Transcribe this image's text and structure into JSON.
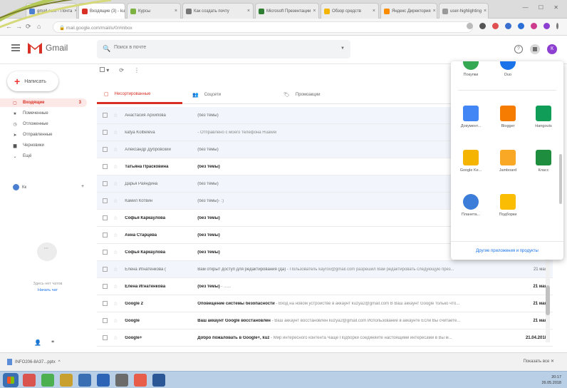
{
  "browser": {
    "tabs": [
      {
        "title": "gmail.com - Почта",
        "color": "#4a7fd1",
        "active": false
      },
      {
        "title": "Входящие (3) - kuz",
        "color": "#d93025",
        "active": true
      },
      {
        "title": "Курсы",
        "color": "#7cb342",
        "active": false
      },
      {
        "title": "Как создать почту",
        "color": "#777777",
        "active": false
      },
      {
        "title": "Microsoft Презентации",
        "color": "#2e7d32",
        "active": false
      },
      {
        "title": "Обзор средств",
        "color": "#f4b400",
        "active": false
      },
      {
        "title": "Яндекс Директория",
        "color": "#fb8c00",
        "active": false
      },
      {
        "title": "user-highlighting",
        "color": "#999999",
        "active": false
      }
    ],
    "url": "mail.google.com/mail/u/0/#inbox",
    "window_controls": "— ☐ ✕"
  },
  "gmail": {
    "logo_word": "Gmail",
    "search_placeholder": "Поиск в почте",
    "help_glyph": "?",
    "avatar_letter": "К",
    "compose_label": "Написать",
    "sidebar": [
      {
        "label": "Входящие",
        "icon": "inbox-icon",
        "glyph": "▢",
        "count": "3",
        "active": true
      },
      {
        "label": "Помеченные",
        "icon": "star-icon",
        "glyph": "★",
        "count": "",
        "active": false
      },
      {
        "label": "Отложенные",
        "icon": "clock-icon",
        "glyph": "◷",
        "count": "",
        "active": false
      },
      {
        "label": "Отправленные",
        "icon": "send-icon",
        "glyph": "➤",
        "count": "",
        "active": false
      },
      {
        "label": "Черновики",
        "icon": "draft-icon",
        "glyph": "▆",
        "count": "",
        "active": false
      },
      {
        "label": "Ещё",
        "icon": "chevron-down-icon",
        "glyph": "⌄",
        "count": "",
        "active": false
      }
    ],
    "hangouts_user": "Кк",
    "no_chats_text": "Здесь нет чатов",
    "start_chat_link": "Начать чат",
    "categories": [
      {
        "label": "Несортированные",
        "icon": "inbox-icon",
        "glyph": "▢",
        "active": true
      },
      {
        "label": "Соцсети",
        "icon": "people-icon",
        "glyph": "👥",
        "active": false
      },
      {
        "label": "Промоакции",
        "icon": "tag-icon",
        "glyph": "🏷",
        "active": false
      }
    ],
    "mails": [
      {
        "sender": "Анастасия Архипова",
        "subject": "(без темы)",
        "snippet": "",
        "date": "",
        "unread": false
      },
      {
        "sender": "katya Kolbeleva",
        "subject": "",
        "snippet": "- Отправлено с моего телефона Huawei",
        "date": "",
        "unread": false
      },
      {
        "sender": "Александр Дубровский",
        "subject": "(без темы)",
        "snippet": "",
        "date": "",
        "unread": false
      },
      {
        "sender": "Татьяна Прасковина",
        "subject": "(без темы)",
        "snippet": "",
        "date": "",
        "unread": true
      },
      {
        "sender": "Дарья Раяндина",
        "subject": "(без темы)",
        "snippet": "",
        "date": "",
        "unread": false
      },
      {
        "sender": "Камил Котвин",
        "subject": "(без темы)",
        "snippet": "- :)",
        "date": "",
        "unread": false
      },
      {
        "sender": "Софья Каркаулова",
        "subject": "(без темы)",
        "snippet": "",
        "date": "",
        "unread": true
      },
      {
        "sender": "Анна Старцева",
        "subject": "(без темы)",
        "snippet": "",
        "date": "",
        "unread": true
      },
      {
        "sender": "Софья Каркаулова",
        "subject": "(без темы)",
        "snippet": "",
        "date": "",
        "unread": true
      },
      {
        "sender": "Елена Игнатенкова (",
        "subject": "Вам открыт доступ для редактирования (да)",
        "snippet": " - Пользователь kayrov@gmail.com разрешил Вам редактировать следующую през...",
        "date": "21 мая",
        "unread": false
      },
      {
        "sender": "Елена Игнатенкова",
        "subject": "(без темы)",
        "snippet": " - ......",
        "date": "21 мая",
        "unread": true
      },
      {
        "sender": "Google 2",
        "subject": "Оповещение системы безопасности",
        "snippet": " - Вход на новом устройстве в аккаунт kuzya2@gmail.com В Ваш аккаунт Google только что...",
        "date": "21 мая",
        "unread": true
      },
      {
        "sender": "Google",
        "subject": "Ваш аккаунт Google восстановлен",
        "snippet": " - Ваш аккаунт восстановлен kuzya2@gmail.com Использование в аккаунте Если Вы считаете...",
        "date": "21 мая",
        "unread": true
      },
      {
        "sender": "Google+",
        "subject": "Добро пожаловать в Google+, kuz",
        "snippet": " - Мир интересного контента Чаще Подборки соединяйте настоящими интересами в Вы м...",
        "date": "21.04.2018",
        "unread": true
      }
    ],
    "apps": {
      "top": [
        {
          "label": "Покупки",
          "color": "#34a853"
        },
        {
          "label": "Duo",
          "color": "#1a73e8"
        }
      ],
      "grid": [
        {
          "label": "Документ...",
          "icon": "docs-icon",
          "color": "#4285f4"
        },
        {
          "label": "Blogger",
          "icon": "blogger-icon",
          "color": "#f57c00"
        },
        {
          "label": "Hangouts",
          "icon": "hangouts-icon",
          "color": "#0f9d58"
        },
        {
          "label": "Google Ke...",
          "icon": "keep-icon",
          "color": "#f4b400"
        },
        {
          "label": "Jamboard",
          "icon": "jamboard-icon",
          "color": "#f9a825"
        },
        {
          "label": "Класс",
          "icon": "classroom-icon",
          "color": "#1e8e3e"
        },
        {
          "label": "Планета...",
          "icon": "earth-icon",
          "color": "#3b7dd8"
        },
        {
          "label": "Подборки",
          "icon": "collections-icon",
          "color": "#fbbc04"
        }
      ],
      "more_label": "Другие приложения и продукты"
    }
  },
  "downloads": {
    "file": "INFO206-8A37...pptx",
    "show_all": "Показать все"
  },
  "taskbar": {
    "icons": [
      "#d9534f",
      "#4caf50",
      "#c8a030",
      "#3b6fb3",
      "#2e64b5",
      "#6b6b6b",
      "#e85d4a",
      "#2b5797"
    ],
    "time": "20:17",
    "date": "26.05.2018"
  }
}
